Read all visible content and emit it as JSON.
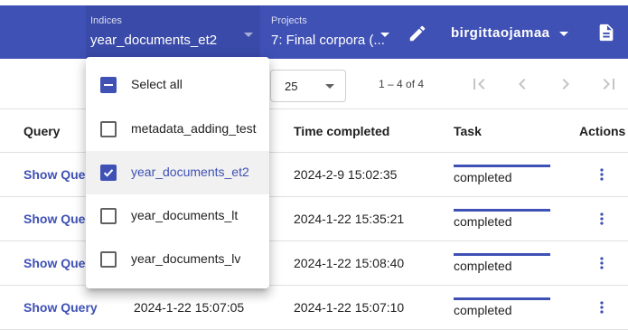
{
  "toolbar": {
    "indices": {
      "label": "Indices",
      "value": "year_documents_et2"
    },
    "projects": {
      "label": "Projects",
      "value": "7: Final corpora (..."
    },
    "username": "birgittaojamaa",
    "icons": [
      "edit-icon",
      "document-icon",
      "chevron-down-icon"
    ]
  },
  "paginator": {
    "page_size": "25",
    "range": "1 – 4 of 4",
    "icons": [
      "first-page-icon",
      "previous-page-icon",
      "next-page-icon",
      "last-page-icon"
    ]
  },
  "table": {
    "headers": {
      "query": "Query",
      "time_completed": "Time completed",
      "task": "Task",
      "actions": "Actions"
    },
    "rows": [
      {
        "query": "Show Query",
        "time_created": "",
        "time_completed": "2024-2-9 15:02:35",
        "task": "completed",
        "progress": 1.0
      },
      {
        "query": "Show Query",
        "time_created": "",
        "time_completed": "2024-1-22 15:35:21",
        "task": "completed",
        "progress": 1.0
      },
      {
        "query": "Show Query",
        "time_created": "",
        "time_completed": "2024-1-22 15:08:40",
        "task": "completed",
        "progress": 1.0
      },
      {
        "query": "Show Query",
        "time_created": "2024-1-22 15:07:05",
        "time_completed": "2024-1-22 15:07:10",
        "task": "completed",
        "progress": 1.0
      }
    ]
  },
  "dropdown": {
    "select_all": "Select all",
    "options": [
      {
        "label": "metadata_adding_test",
        "checked": false
      },
      {
        "label": "year_documents_et2",
        "checked": true
      },
      {
        "label": "year_documents_lt",
        "checked": false
      },
      {
        "label": "year_documents_lv",
        "checked": false
      }
    ]
  },
  "colors": {
    "primary": "#3f51b5",
    "toolbar": "#3f51b5",
    "row_hover": "#f1f1f1"
  }
}
